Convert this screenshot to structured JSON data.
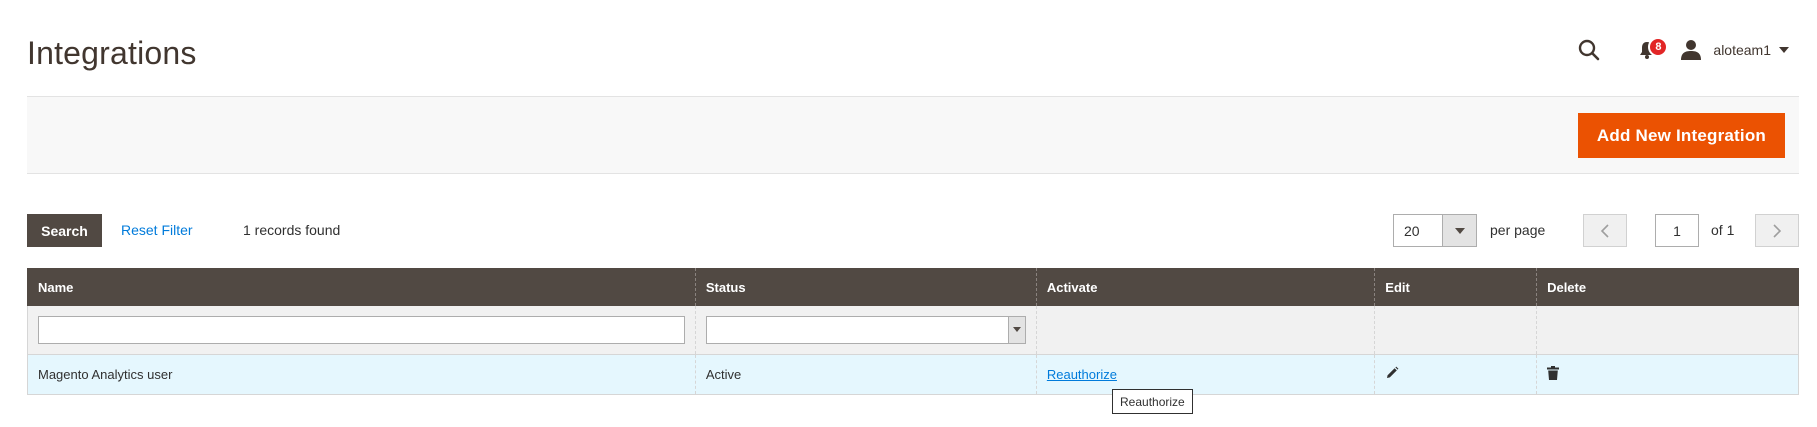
{
  "header": {
    "title": "Integrations",
    "notifications_count": "8",
    "user_name": "aloteam1"
  },
  "actions": {
    "add_button_label": "Add New Integration"
  },
  "toolbar": {
    "search_label": "Search",
    "reset_filter_label": "Reset Filter",
    "records_found": "1 records found",
    "per_page_value": "20",
    "per_page_label": "per page",
    "current_page": "1",
    "total_pages_label": "of 1"
  },
  "grid": {
    "columns": [
      "Name",
      "Status",
      "Activate",
      "Edit",
      "Delete"
    ],
    "filters": {
      "name_value": "",
      "status_value": ""
    },
    "rows": [
      {
        "name": "Magento Analytics user",
        "status": "Active",
        "activate": "Reauthorize"
      }
    ]
  },
  "tooltip": {
    "text": "Reauthorize"
  },
  "icons": {
    "search": "search-icon",
    "notifications": "bell-icon",
    "user": "user-icon",
    "edit": "pencil-icon",
    "delete": "trash-icon",
    "prev": "chevron-left-icon",
    "next": "chevron-right-icon"
  },
  "colors": {
    "accent": "#eb5202",
    "grid_header": "#514943",
    "link": "#007bdb",
    "badge": "#e22626",
    "row_highlight": "#e5f7fe"
  }
}
